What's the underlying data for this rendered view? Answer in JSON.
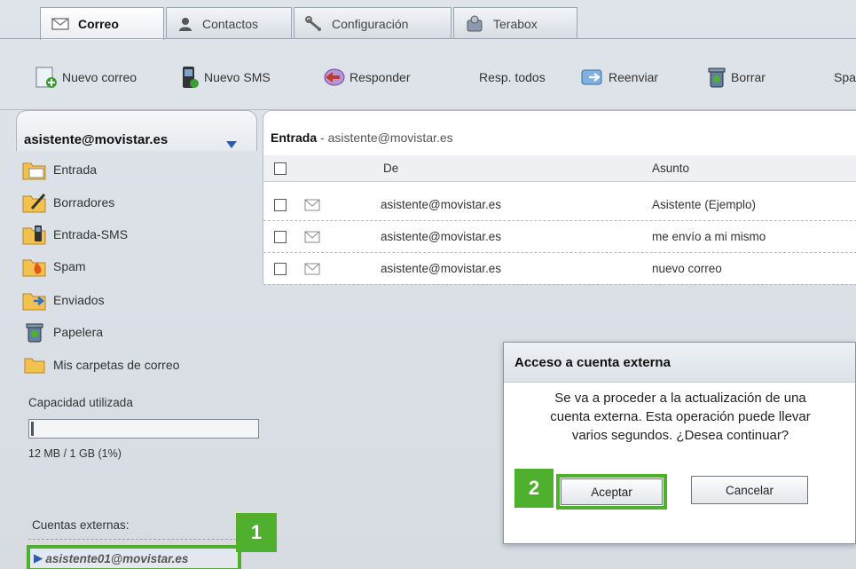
{
  "tabs": [
    {
      "label": "Correo",
      "icon": "envelope-icon",
      "active": true
    },
    {
      "label": "Contactos",
      "icon": "contacts-icon",
      "active": false
    },
    {
      "label": "Configuración",
      "icon": "wrench-icon",
      "active": false
    },
    {
      "label": "Terabox",
      "icon": "terabox-icon",
      "active": false
    }
  ],
  "toolbar": {
    "new_mail": "Nuevo correo",
    "new_sms": "Nuevo SMS",
    "reply": "Responder",
    "reply_all": "Resp. todos",
    "forward": "Reenviar",
    "delete": "Borrar",
    "spam_partial": "Spa"
  },
  "sidebar": {
    "account": "asistente@movistar.es",
    "folders": [
      {
        "label": "Entrada",
        "icon": "inbox-folder-icon"
      },
      {
        "label": "Borradores",
        "icon": "drafts-folder-icon"
      },
      {
        "label": "Entrada-SMS",
        "icon": "sms-folder-icon"
      },
      {
        "label": "Spam",
        "icon": "spam-folder-icon"
      },
      {
        "label": "Enviados",
        "icon": "sent-folder-icon"
      },
      {
        "label": "Papelera",
        "icon": "trash-icon"
      },
      {
        "label": "Mis carpetas de correo",
        "icon": "folder-icon"
      }
    ],
    "capacity_label": "Capacidad utilizada",
    "capacity_text": "12 MB / 1 GB (1%)",
    "capacity_fraction": 0.01,
    "external_label": "Cuentas externas:",
    "external_account": "asistente01@movistar.es"
  },
  "list": {
    "title": "Entrada",
    "title_suffix": "- asistente@movistar.es",
    "headers": {
      "from": "De",
      "subject": "Asunto"
    },
    "rows": [
      {
        "from": "asistente@movistar.es",
        "subject": "Asistente (Ejemplo)"
      },
      {
        "from": "asistente@movistar.es",
        "subject": "me envío a mi mismo"
      },
      {
        "from": "asistente@movistar.es",
        "subject": "nuevo correo"
      }
    ]
  },
  "dialog": {
    "title": "Acceso a cuenta externa",
    "line1": "Se va a proceder a la actualización de una",
    "line2": "cuenta externa. Esta operación puede llevar",
    "line3": "varios segundos. ¿Desea continuar?",
    "accept": "Aceptar",
    "cancel": "Cancelar"
  },
  "badges": {
    "one": "1",
    "two": "2"
  },
  "colors": {
    "highlight": "#4fb02d",
    "accent": "#2a5db0"
  }
}
